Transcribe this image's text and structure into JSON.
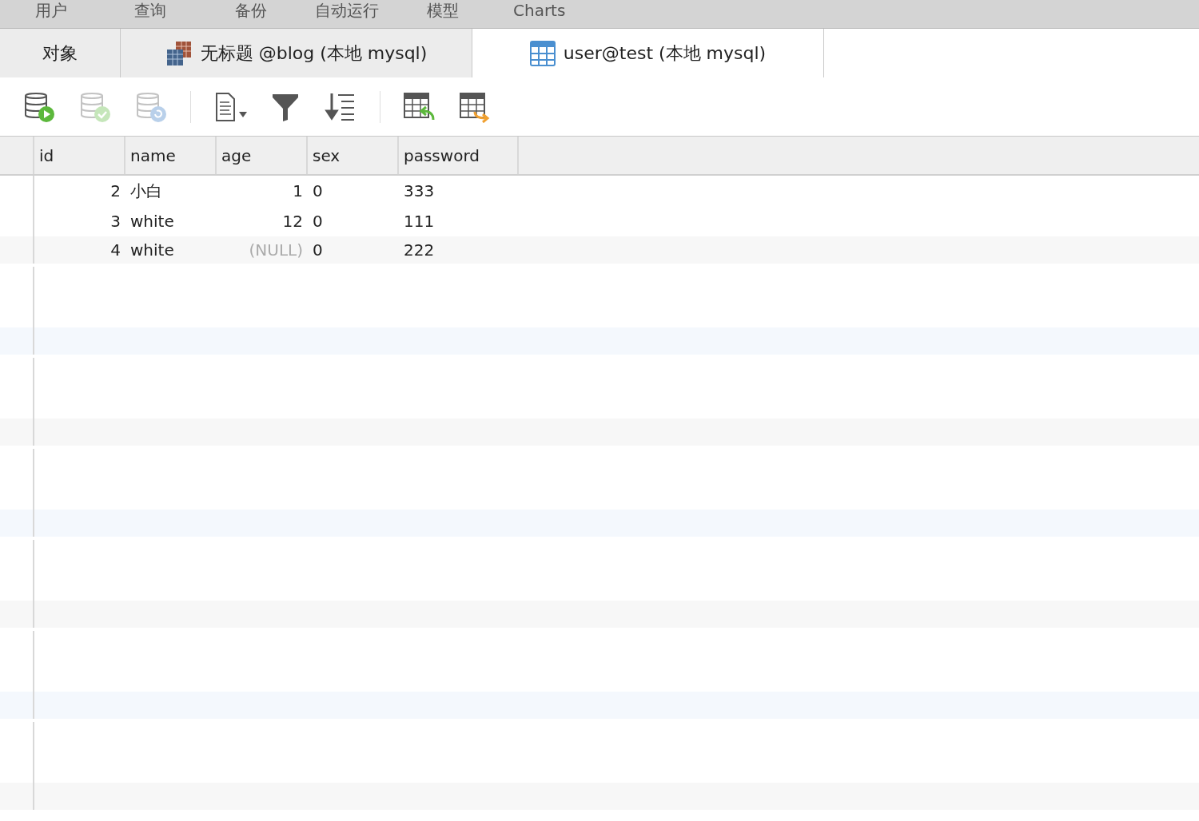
{
  "menu": [
    {
      "label": "用户"
    },
    {
      "label": "查询"
    },
    {
      "label": "备份"
    },
    {
      "label": "自动运行"
    },
    {
      "label": "模型"
    },
    {
      "label": "Charts"
    }
  ],
  "tabs": [
    {
      "label": "对象",
      "kind": "plain",
      "selected": false
    },
    {
      "label": "无标题 @blog (本地 mysql)",
      "kind": "query",
      "selected": false
    },
    {
      "label": "user@test (本地 mysql)",
      "kind": "table",
      "selected": true
    }
  ],
  "toolbar": [
    {
      "kind": "db-run",
      "disabled": false
    },
    {
      "kind": "db-apply",
      "disabled": true
    },
    {
      "kind": "db-revert",
      "disabled": true
    },
    {
      "kind": "separator"
    },
    {
      "kind": "document",
      "disabled": false
    },
    {
      "kind": "filter",
      "disabled": false
    },
    {
      "kind": "sort",
      "disabled": false
    },
    {
      "kind": "separator"
    },
    {
      "kind": "import",
      "disabled": false
    },
    {
      "kind": "export",
      "disabled": false
    }
  ],
  "table": {
    "columns": [
      "id",
      "name",
      "age",
      "sex",
      "password"
    ],
    "rows": [
      [
        {
          "text": "2",
          "kind": "number"
        },
        {
          "text": "小白",
          "kind": "text"
        },
        {
          "text": "1",
          "kind": "number"
        },
        {
          "text": "0",
          "kind": "text"
        },
        {
          "text": "333",
          "kind": "text"
        }
      ],
      [
        {
          "text": "3",
          "kind": "number"
        },
        {
          "text": "white",
          "kind": "text"
        },
        {
          "text": "12",
          "kind": "number"
        },
        {
          "text": "0",
          "kind": "text"
        },
        {
          "text": "111",
          "kind": "text"
        }
      ],
      [
        {
          "text": "4",
          "kind": "number"
        },
        {
          "text": "white",
          "kind": "text"
        },
        {
          "text": "(NULL)",
          "kind": "null"
        },
        {
          "text": "0",
          "kind": "text"
        },
        {
          "text": "222",
          "kind": "text"
        }
      ]
    ]
  }
}
